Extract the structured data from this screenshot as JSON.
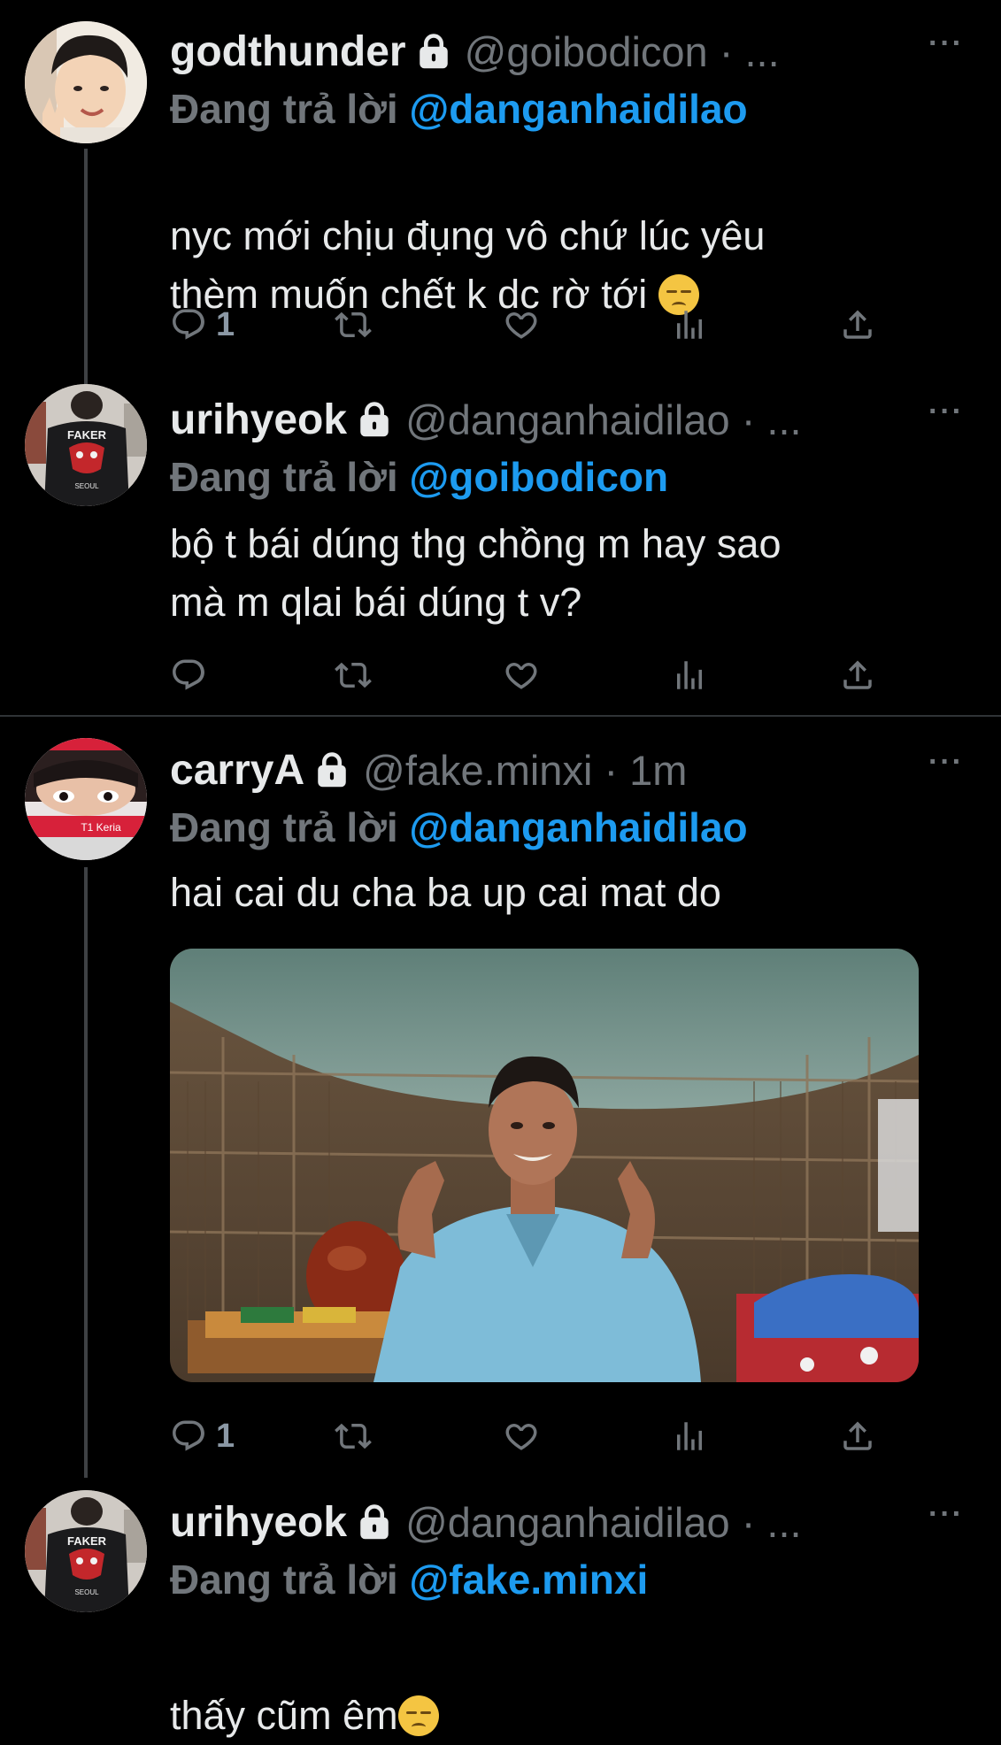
{
  "tweets": [
    {
      "name": "godthunder",
      "handle": "@goibodicon · ...",
      "reply_prefix": "Đang trả lời",
      "reply_to": "@danganhaidilao",
      "text": "nyc mới chịu đụng vô chứ lúc yêu\nthèm muốn chết k dc rờ tới",
      "emoji": "pensive-face-emoji",
      "reply_count": "1",
      "avatar": "child-avatar"
    },
    {
      "name": "urihyeok",
      "handle": "@danganhaidilao · ...",
      "reply_prefix": "Đang trả lời",
      "reply_to": "@goibodicon",
      "text": "bộ t bái dúng thg chồng m hay sao\nmà m qlai bái dúng t v?",
      "reply_count": "",
      "avatar": "faker-jacket-avatar",
      "avatar_text": [
        "FAKER",
        "SEOUL"
      ]
    },
    {
      "name": "carryA",
      "handle": "@fake.minxi · 1m",
      "reply_prefix": "Đang trả lời",
      "reply_to": "@danganhaidilao",
      "text": "hai cai du cha ba up cai mat do",
      "reply_count": "1",
      "avatar": "t1-keria-avatar",
      "avatar_text": "T1 Keria",
      "media": "video-thumbnail-man-in-hut"
    },
    {
      "name": "urihyeok",
      "handle": "@danganhaidilao · ...",
      "reply_prefix": "Đang trả lời",
      "reply_to": "@fake.minxi",
      "text": "thấy cũm êm",
      "emoji": "pensive-face-emoji",
      "avatar": "faker-jacket-avatar",
      "avatar_text": [
        "FAKER",
        "SEOUL"
      ]
    }
  ],
  "more_label": "···",
  "colors": {
    "background": "#000000",
    "text": "#e7e9ea",
    "muted": "#71767b",
    "accent": "#1d9bf0",
    "divider": "#2f3336"
  }
}
